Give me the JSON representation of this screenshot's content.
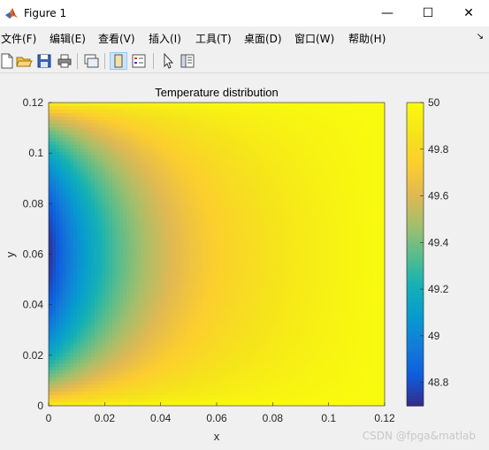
{
  "window": {
    "title": "Figure 1",
    "controls": {
      "minimize": "—",
      "maximize": "☐",
      "close": "✕"
    }
  },
  "menu": {
    "items": [
      "文件(F)",
      "编辑(E)",
      "查看(V)",
      "插入(I)",
      "工具(T)",
      "桌面(D)",
      "窗口(W)",
      "帮助(H)"
    ],
    "overflow_arrow": "↘"
  },
  "toolbar": {
    "buttons": [
      "new-figure-icon",
      "open-file-icon",
      "save-icon",
      "print-icon",
      "link-plot-icon",
      "dock-figure-icon",
      "insert-legend-icon",
      "pointer-icon",
      "property-inspector-icon"
    ],
    "active": "dock-figure-icon"
  },
  "chart_data": {
    "type": "heatmap",
    "title": "Temperature distribution",
    "xlabel": "x",
    "ylabel": "y",
    "xlim": [
      0,
      0.12
    ],
    "ylim": [
      0,
      0.12
    ],
    "xticks": [
      "0",
      "0.02",
      "0.04",
      "0.06",
      "0.08",
      "0.1",
      "0.12"
    ],
    "yticks": [
      "0",
      "0.02",
      "0.04",
      "0.06",
      "0.08",
      "0.1",
      "0.12"
    ],
    "colormap": "parula",
    "colorbar": {
      "clim": [
        48.7,
        50
      ],
      "ticks": [
        "48.8",
        "49",
        "49.2",
        "49.4",
        "49.6",
        "49.8",
        "50"
      ]
    },
    "field": {
      "description_min_at": [
        0,
        0.06
      ],
      "min_value": 48.72,
      "max_value": 50,
      "boundary_value": 50
    }
  },
  "watermark": "CSDN @fpga&matlab"
}
